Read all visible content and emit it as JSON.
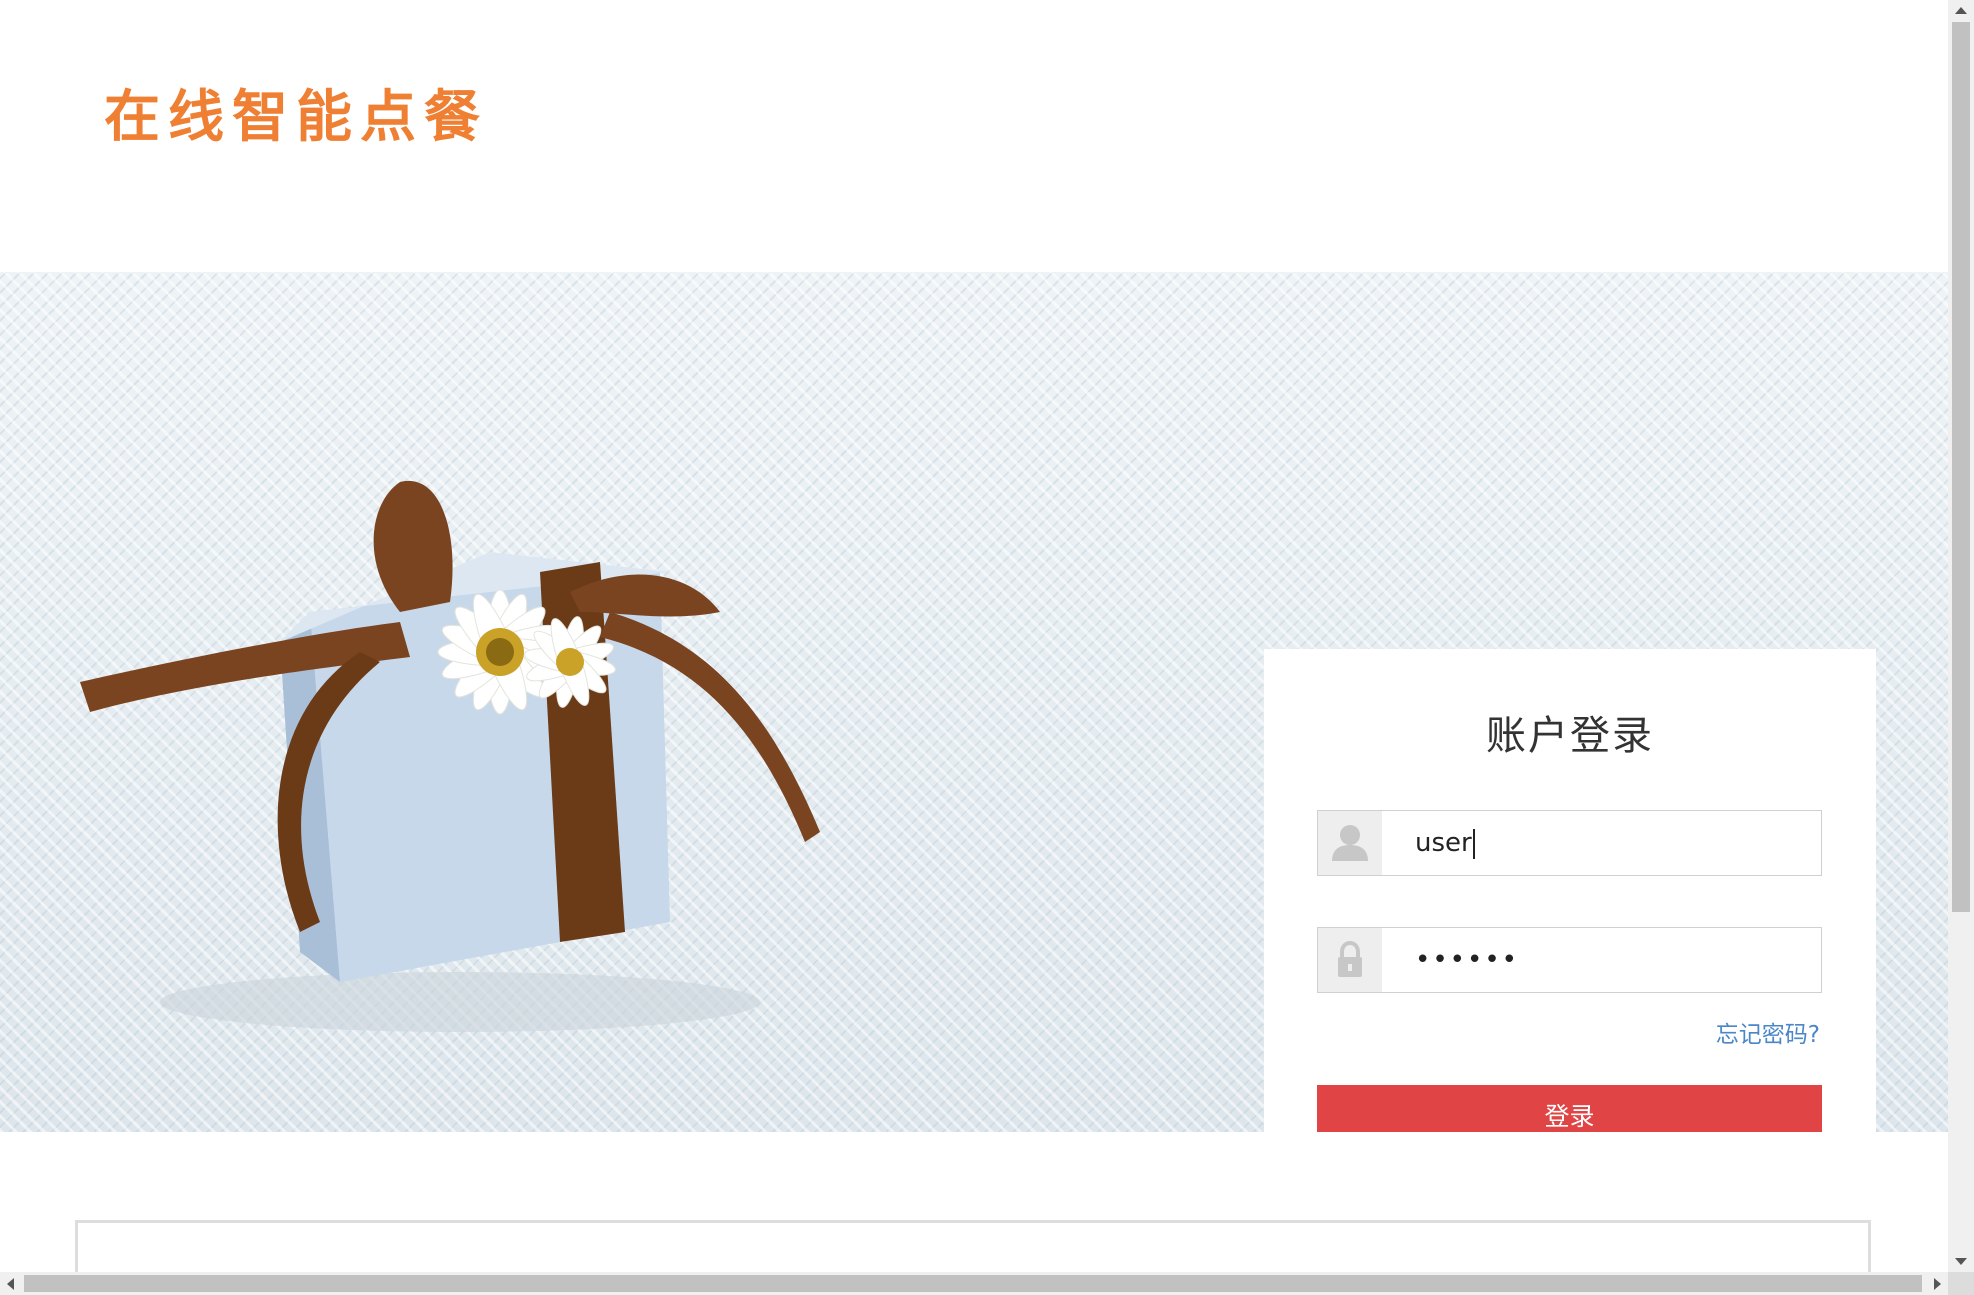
{
  "header": {
    "logo_text": "在线智能点餐"
  },
  "login": {
    "title": "账户登录",
    "username_value": "user",
    "password_value": "••••••",
    "forgot_label": "忘记密码?",
    "submit_label": "登录",
    "icons": {
      "username": "user-icon",
      "password": "lock-icon"
    }
  },
  "colors": {
    "logo": "#ef7f32",
    "login_button": "#e04444",
    "forgot_link": "#4a86c8"
  }
}
